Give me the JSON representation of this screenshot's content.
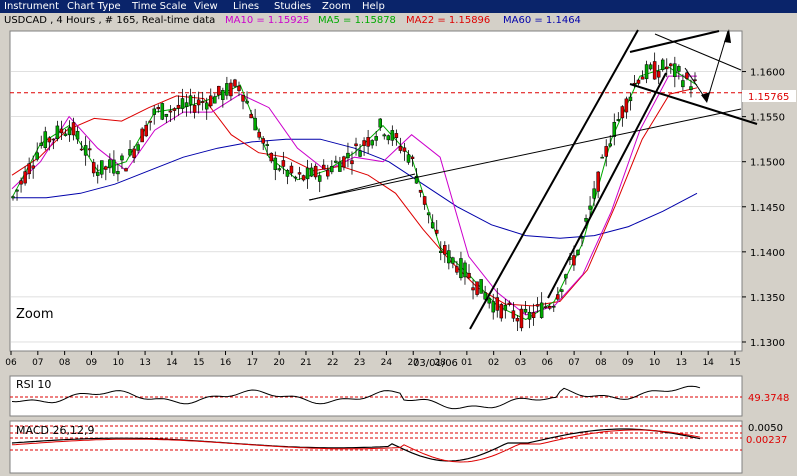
{
  "menu": [
    "Instrument",
    "Chart Type",
    "Time Scale",
    "View",
    "Lines",
    "Studies",
    "Zoom",
    "Help"
  ],
  "header": {
    "symbol_text": "USDCAD , 4 Hours , # 165, Real-time data",
    "indicators": [
      {
        "text": "MA10 = 1.15925",
        "color": "#cc00cc"
      },
      {
        "text": "MA5 = 1.15878",
        "color": "#00aa00"
      },
      {
        "text": "MA22 = 1.15896",
        "color": "#dd0000"
      },
      {
        "text": "MA60 = 1.1464",
        "color": "#0000aa"
      }
    ]
  },
  "zoom_label": "Zoom",
  "price_label": "1.15765",
  "date_label": "03/01/06",
  "rsi": {
    "title": "RSI 10",
    "value_label": "49.3748"
  },
  "macd": {
    "title": "MACD 26,12,9",
    "value_top": "0.0050",
    "value_bottom": "0.00237"
  },
  "colors": {
    "up_candle": "#00aa00",
    "down_candle": "#dd0000",
    "ma5": "#00aa00",
    "ma10": "#cc00cc",
    "ma22": "#dd0000",
    "ma60": "#0000aa",
    "background": "#ffffff",
    "frame": "#d4d0c8"
  },
  "chart_data": {
    "type": "candlestick",
    "ylim": [
      1.129,
      1.1645
    ],
    "y_ticks": [
      "1.1300",
      "1.1350",
      "1.1400",
      "1.1450",
      "1.1500",
      "1.1550",
      "1.1600"
    ],
    "x_ticks": [
      "06",
      "07",
      "08",
      "09",
      "10",
      "13",
      "14",
      "15",
      "16",
      "17",
      "20",
      "21",
      "22",
      "23",
      "24",
      "27",
      "28",
      "01",
      "02",
      "03",
      "06",
      "07",
      "08",
      "09",
      "10",
      "13",
      "14",
      "15"
    ],
    "horizontal_level": 1.15765,
    "ma_series": [
      {
        "name": "MA60",
        "values": [
          1.146,
          1.146,
          1.1465,
          1.1475,
          1.149,
          1.1505,
          1.1515,
          1.1522,
          1.1525,
          1.1525,
          1.1515,
          1.15,
          1.1475,
          1.145,
          1.143,
          1.1418,
          1.1415,
          1.1418,
          1.1428,
          1.1445,
          1.1465
        ]
      },
      {
        "name": "MA22",
        "values": [
          1.1485,
          1.1505,
          1.1535,
          1.1548,
          1.1545,
          1.156,
          1.1573,
          1.157,
          1.153,
          1.151,
          1.1505,
          1.149,
          1.1495,
          1.1485,
          1.1465,
          1.1425,
          1.139,
          1.136,
          1.1342,
          1.134,
          1.1345,
          1.138,
          1.145,
          1.1525,
          1.1575,
          1.1582
        ]
      },
      {
        "name": "MA10",
        "values": [
          1.147,
          1.15,
          1.155,
          1.1515,
          1.149,
          1.1535,
          1.1555,
          1.1555,
          1.1575,
          1.156,
          1.1515,
          1.149,
          1.1505,
          1.15,
          1.153,
          1.1505,
          1.1395,
          1.1355,
          1.133,
          1.134,
          1.1375,
          1.1445,
          1.1535,
          1.1595,
          1.1595
        ]
      },
      {
        "name": "MA5",
        "values": [
          1.146,
          1.152,
          1.154,
          1.149,
          1.15,
          1.1555,
          1.156,
          1.157,
          1.1585,
          1.1505,
          1.148,
          1.149,
          1.151,
          1.154,
          1.1505,
          1.1405,
          1.1375,
          1.134,
          1.1325,
          1.1345,
          1.141,
          1.1525,
          1.1595,
          1.1605,
          1.1585
        ]
      }
    ],
    "rsi_value": 49.3748,
    "macd_values": [
      0.005,
      0.00237
    ]
  }
}
